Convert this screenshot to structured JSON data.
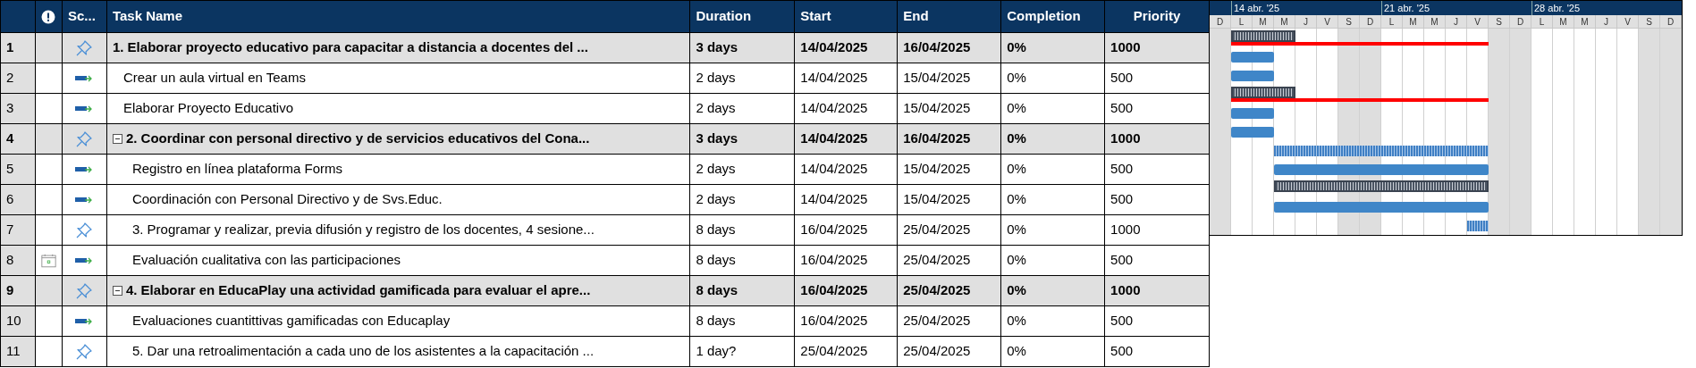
{
  "table": {
    "columns": [
      "Sc...",
      "Task Name",
      "Duration",
      "Start",
      "End",
      "Completion",
      "Priority"
    ],
    "rows": [
      {
        "id": "1",
        "name": "1. Elaborar proyecto educativo para capacitar a distancia a docentes del ...",
        "kind": "manual",
        "summary": true,
        "critical": true,
        "constraint": false,
        "duration": "3 days",
        "start": "14/04/2025",
        "end": "16/04/2025",
        "completion": "0%",
        "priority": "1000",
        "children": [
          {
            "id": "2",
            "name": "Crear un aula virtual en Teams",
            "kind": "auto",
            "summary": false,
            "constraint": false,
            "duration": "2 days",
            "start": "14/04/2025",
            "end": "15/04/2025",
            "completion": "0%",
            "priority": "500"
          },
          {
            "id": "3",
            "name": "Elaborar Proyecto Educativo",
            "kind": "auto",
            "summary": false,
            "constraint": false,
            "duration": "2 days",
            "start": "14/04/2025",
            "end": "15/04/2025",
            "completion": "0%",
            "priority": "500"
          }
        ]
      },
      {
        "id": "4",
        "name": "2. Coordinar con personal directivo y de servicios educativos del Cona...",
        "kind": "manual",
        "summary": true,
        "critical": true,
        "constraint": false,
        "expanded": true,
        "duration": "3 days",
        "start": "14/04/2025",
        "end": "16/04/2025",
        "completion": "0%",
        "priority": "1000",
        "children": [
          {
            "id": "5",
            "name": "Registro en línea plataforma Forms",
            "kind": "auto",
            "summary": false,
            "constraint": false,
            "duration": "2 days",
            "start": "14/04/2025",
            "end": "15/04/2025",
            "completion": "0%",
            "priority": "500"
          },
          {
            "id": "6",
            "name": "Coordinación con Personal Directivo y de Svs.Educ.",
            "kind": "auto",
            "summary": false,
            "constraint": false,
            "duration": "2 days",
            "start": "14/04/2025",
            "end": "15/04/2025",
            "completion": "0%",
            "priority": "500"
          },
          {
            "id": "7",
            "name": "3. Programar y realizar, previa difusión y registro de los docentes, 4 sesione...",
            "kind": "manual",
            "summary": false,
            "constraint": false,
            "duration": "8 days",
            "start": "16/04/2025",
            "end": "25/04/2025",
            "completion": "0%",
            "priority": "1000"
          },
          {
            "id": "8",
            "name": "Evaluación cualitativa con las participaciones",
            "kind": "auto",
            "summary": false,
            "constraint": true,
            "duration": "8 days",
            "start": "16/04/2025",
            "end": "25/04/2025",
            "completion": "0%",
            "priority": "500"
          }
        ]
      },
      {
        "id": "9",
        "name": "4. Elaborar en EducaPlay una actividad gamificada para evaluar el apre...",
        "kind": "manual",
        "summary": true,
        "critical": false,
        "constraint": false,
        "expanded": true,
        "duration": "8 days",
        "start": "16/04/2025",
        "end": "25/04/2025",
        "completion": "0%",
        "priority": "1000",
        "children": [
          {
            "id": "10",
            "name": "Evaluaciones cuantittivas gamificadas con Educaplay",
            "kind": "auto",
            "summary": false,
            "constraint": false,
            "duration": "8 days",
            "start": "16/04/2025",
            "end": "25/04/2025",
            "completion": "0%",
            "priority": "500"
          },
          {
            "id": "11",
            "name": "5. Dar una retroalimentación a cada uno de los asistentes a la capacitación ...",
            "kind": "manual",
            "summary": false,
            "constraint": false,
            "duration": "1 day?",
            "start": "25/04/2025",
            "end": "25/04/2025",
            "completion": "0%",
            "priority": "500"
          }
        ]
      }
    ]
  },
  "timeline": {
    "weeks": [
      {
        "label": "14 abr. '25"
      },
      {
        "label": "21 abr. '25"
      },
      {
        "label": "28 abr. '25"
      }
    ],
    "days": [
      {
        "label": "D",
        "weekend": true
      },
      {
        "label": "L",
        "weekend": false
      },
      {
        "label": "M",
        "weekend": false
      },
      {
        "label": "M",
        "weekend": false
      },
      {
        "label": "J",
        "weekend": false
      },
      {
        "label": "V",
        "weekend": false
      },
      {
        "label": "S",
        "weekend": true
      },
      {
        "label": "D",
        "weekend": true
      },
      {
        "label": "L",
        "weekend": false
      },
      {
        "label": "M",
        "weekend": false
      },
      {
        "label": "M",
        "weekend": false
      },
      {
        "label": "J",
        "weekend": false
      },
      {
        "label": "V",
        "weekend": false
      },
      {
        "label": "S",
        "weekend": true
      },
      {
        "label": "D",
        "weekend": true
      },
      {
        "label": "L",
        "weekend": false
      },
      {
        "label": "M",
        "weekend": false
      },
      {
        "label": "M",
        "weekend": false
      },
      {
        "label": "J",
        "weekend": false
      },
      {
        "label": "V",
        "weekend": false
      },
      {
        "label": "S",
        "weekend": true
      },
      {
        "label": "D",
        "weekend": true
      }
    ]
  }
}
